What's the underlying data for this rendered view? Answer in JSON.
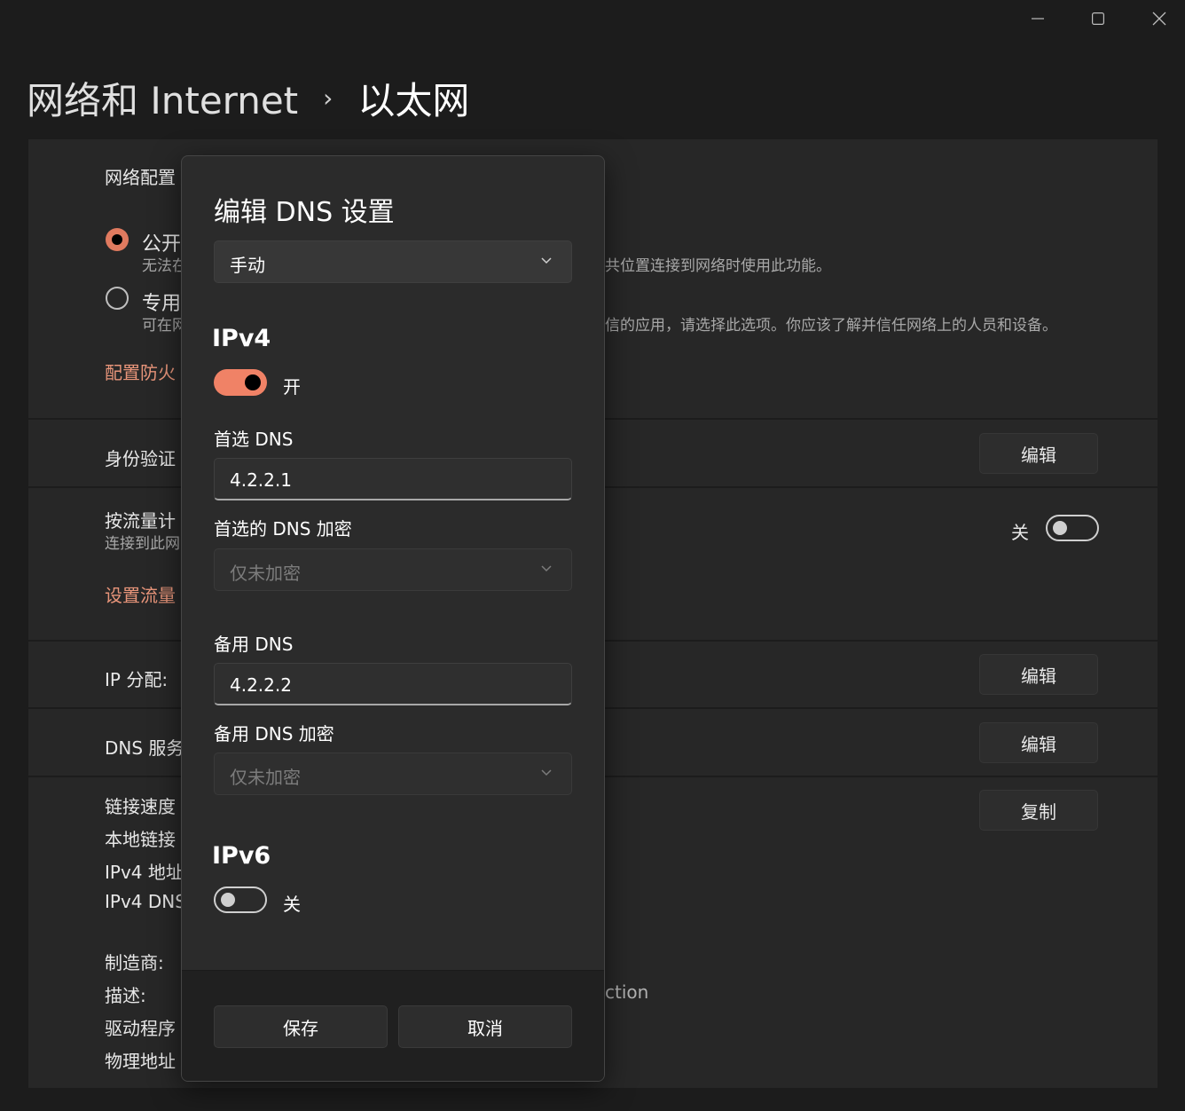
{
  "window": {
    "minimize_icon": "minimize-icon",
    "maximize_icon": "maximize-icon",
    "close_icon": "close-icon"
  },
  "breadcrumb": {
    "parent": "网络和 Internet",
    "separator": "›",
    "current": "以太网"
  },
  "background": {
    "network_profile_label": "网络配置",
    "public_label": "公开",
    "public_desc_left": "无法在",
    "public_desc_right": "共位置连接到网络时使用此功能。",
    "private_label": "专用",
    "private_desc_left": "可在网",
    "private_desc_right": "信的应用，请选择此选项。你应该了解并信任网络上的人员和设备。",
    "firewall_link": "配置防火",
    "auth_label": "身份验证",
    "auth_button": "编辑",
    "metered_label": "按流量计",
    "metered_desc": "连接到此网",
    "metered_state": "关",
    "data_limit_link": "设置流量",
    "ip_assign_label": "IP 分配:",
    "ip_assign_button": "编辑",
    "dns_server_label": "DNS 服务",
    "dns_server_button": "编辑",
    "copy_button": "复制",
    "props": [
      "链接速度",
      "本地链接",
      "IPv4 地址",
      "IPv4 DNS"
    ],
    "hw": [
      "制造商:",
      "描述:",
      "驱动程序",
      "物理地址"
    ],
    "description_tail": "ction"
  },
  "dialog": {
    "title": "编辑 DNS 设置",
    "mode_select": "手动",
    "ipv4": {
      "heading": "IPv4",
      "toggle_on": true,
      "toggle_label": "开",
      "preferred_dns_label": "首选 DNS",
      "preferred_dns_value": "4.2.2.1",
      "preferred_encryption_label": "首选的 DNS 加密",
      "preferred_encryption_value": "仅未加密",
      "alternate_dns_label": "备用 DNS",
      "alternate_dns_value": "4.2.2.2",
      "alternate_encryption_label": "备用 DNS 加密",
      "alternate_encryption_value": "仅未加密"
    },
    "ipv6": {
      "heading": "IPv6",
      "toggle_on": false,
      "toggle_label": "关"
    },
    "save_button": "保存",
    "cancel_button": "取消"
  },
  "colors": {
    "accent": "#f08266",
    "link": "#e8957a",
    "background": "#1c1c1c",
    "panel": "#272727",
    "dialog": "#2b2b2b"
  }
}
